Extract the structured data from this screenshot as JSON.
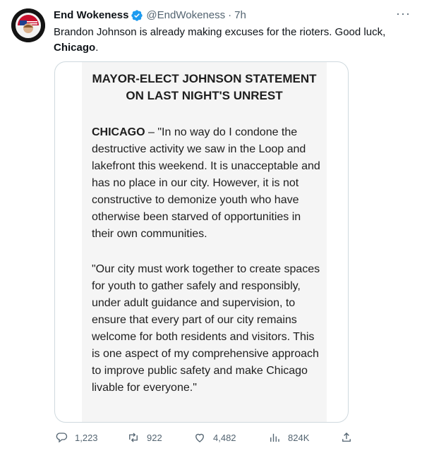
{
  "tweet": {
    "author_name": "End Wokeness",
    "handle": "@EndWokeness",
    "separator": "·",
    "time": "7h",
    "more": "···",
    "text_before": "Brandon Johnson is already making excuses for the rioters. Good luck, ",
    "text_bold": "Chicago",
    "text_after": "."
  },
  "media": {
    "title_line1": "MAYOR-ELECT JOHNSON STATEMENT",
    "title_line2": "ON LAST NIGHT'S UNREST",
    "para1_bold": "CHICAGO",
    "para1_text": " – \"In no way do I condone the destructive activity we saw in the Loop and lakefront this weekend. It is unacceptable and has no place in our city. However, it is not constructive to demonize youth who have otherwise been starved of opportunities in their own communities.",
    "para2_text": "\"Our city must work together to create spaces for youth to gather safely and responsibly, under adult guidance and supervision, to ensure that every part of our city remains welcome for both residents and visitors. This is one aspect of my comprehensive approach to improve public safety and make Chicago livable for everyone.\""
  },
  "actions": {
    "replies": "1,223",
    "retweets": "922",
    "likes": "4,482",
    "views": "824K"
  },
  "icons": {
    "verified": "verified-badge-icon",
    "reply": "reply-icon",
    "retweet": "retweet-icon",
    "like": "heart-icon",
    "views": "views-icon",
    "share": "share-icon"
  },
  "colors": {
    "verified": "#1d9bf0",
    "secondary_text": "#536471"
  }
}
